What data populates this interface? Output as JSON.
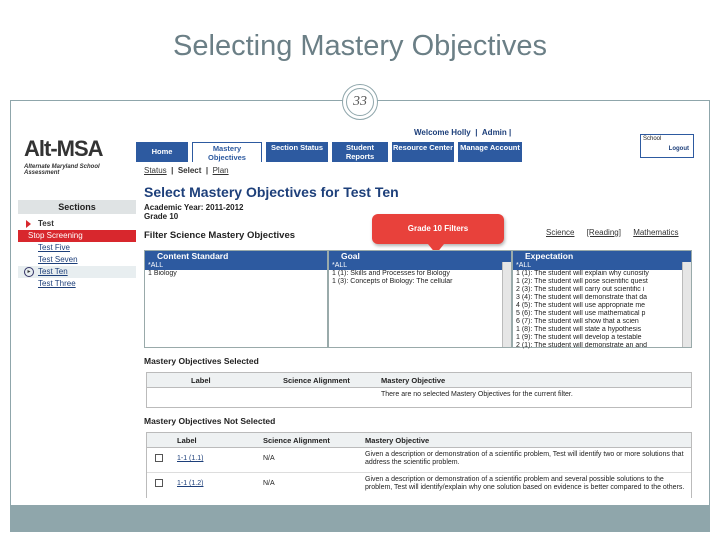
{
  "slide": {
    "title": "Selecting Mastery Objectives",
    "page_number": "33"
  },
  "sidebar": {
    "logo_text": "Alt-MSA",
    "logo_subtitle": "Alternate Maryland School Assessment",
    "sections_label": "Sections",
    "items": [
      {
        "label": "Test"
      },
      {
        "label": "Stop Screening"
      },
      {
        "label": "Test Five"
      },
      {
        "label": "Test Seven"
      },
      {
        "label": "Test Ten"
      },
      {
        "label": "Test Three"
      }
    ]
  },
  "header": {
    "welcome": "Welcome Holly",
    "admin": "Admin |",
    "school_label": "School",
    "logout": "Logout",
    "tabs": [
      "Home",
      "Mastery Objectives",
      "Section Status",
      "Student Reports",
      "Resource Center",
      "Manage Account"
    ],
    "subnav": [
      "Status",
      "|",
      "Select",
      "|",
      "Plan"
    ]
  },
  "main": {
    "title": "Select Mastery Objectives for Test Ten",
    "year": "Academic Year: 2011-2012",
    "grade": "Grade 10",
    "filter_title": "Filter Science Mastery Objectives",
    "callout": "Grade 10 Filters",
    "subjects": [
      "Science",
      "[Reading]",
      "Mathematics"
    ],
    "filters": {
      "content_standard": {
        "header": "Content Standard",
        "items": [
          "*ALL",
          "1 Biology"
        ]
      },
      "goal": {
        "header": "Goal",
        "items": [
          "*ALL",
          "1 (1): Skills and Processes for Biology",
          "1 (3): Concepts of Biology: The cellular"
        ]
      },
      "expectation": {
        "header": "Expectation",
        "items": [
          "*ALL",
          "1 (1): The student will explain why curiosity",
          "1 (2): The student will pose scientific quest",
          "2 (3): The student will carry out scientific i",
          "3 (4): The student will demonstrate that da",
          "4 (5): The student will use appropriate me",
          "5 (6): The student will use mathematical p",
          "6 (7): The student will show that a scien",
          "1 (8): The student will state a hypothesis",
          "1 (9): The student will develop a testable",
          "2 (1): The student will demonstrate an and"
        ]
      }
    },
    "selected": {
      "title": "Mastery Objectives    Selected",
      "columns": [
        "Label",
        "Science Alignment",
        "Mastery Objective"
      ],
      "empty_message": "There are no selected Mastery Objectives for the current filter."
    },
    "not_selected": {
      "title": "Mastery Objectives    Not Selected",
      "columns": [
        "Label",
        "Science Alignment",
        "Mastery Objective"
      ],
      "rows": [
        {
          "label": "1-1 (1.1)",
          "alignment": "N/A",
          "objective": "Given a description or demonstration of a scientific problem, Test will identify two or more solutions that address the scientific problem."
        },
        {
          "label": "1-1 (1.2)",
          "alignment": "N/A",
          "objective": "Given a description or demonstration of a scientific problem and several possible solutions to the problem, Test will identify/explain why one solution based on evidence is better compared to the others."
        }
      ]
    }
  },
  "colors": {
    "accent": "#2d5aa0",
    "alert": "#d8272d",
    "slide_frame": "#8fa6ab"
  }
}
